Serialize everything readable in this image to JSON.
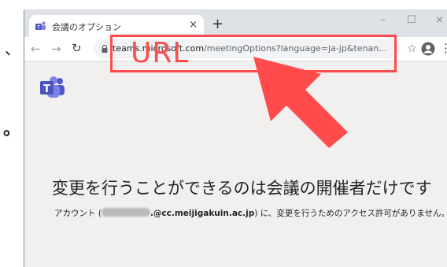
{
  "colors": {
    "titlebar": "#dee1e6",
    "page_background": "#f1f0ef",
    "annotation_red": "#ff4b4b",
    "teams_purple": "#5059c9"
  },
  "side_marks": {
    "top": "、",
    "middle": "。"
  },
  "browser": {
    "tab_title": "会議のオプション",
    "tab_close": "×",
    "new_tab": "+",
    "url_host": "teams.microsoft.com",
    "url_path": "/meetingOptions?language=ja-jp&tenan...",
    "window_controls": [
      "–",
      "☐",
      "×"
    ]
  },
  "page": {
    "heading": "変更を行うことができるのは会議の開催者だけです",
    "note_prefix": "アカウント (",
    "note_email": ".@cc.meijigakuin.ac.jp",
    "note_suffix": ") に、変更を行うためのアクセス許可がありません。"
  },
  "annotation": {
    "label": "URL"
  }
}
